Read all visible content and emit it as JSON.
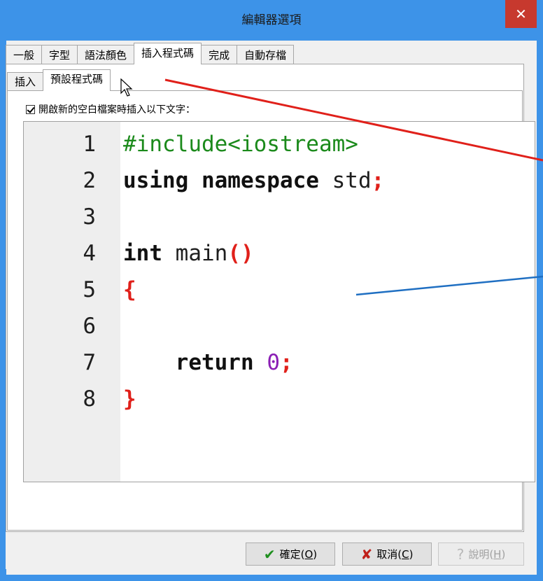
{
  "window": {
    "title": "編輯器選項",
    "close_glyph": "✕"
  },
  "tabs": [
    {
      "label": "一般"
    },
    {
      "label": "字型"
    },
    {
      "label": "語法顏色"
    },
    {
      "label": "插入程式碼",
      "active": true
    },
    {
      "label": "完成"
    },
    {
      "label": "自動存檔"
    }
  ],
  "subtabs": [
    {
      "label": "插入"
    },
    {
      "label": "預設程式碼",
      "active": true
    }
  ],
  "checkbox": {
    "label": "開啟新的空白檔案時插入以下文字：",
    "checked": true
  },
  "editor": {
    "lines": [
      {
        "no": "1",
        "text": "#include<iostream>"
      },
      {
        "no": "2",
        "text": "using namespace std;"
      },
      {
        "no": "3",
        "text": ""
      },
      {
        "no": "4",
        "text": "int main()"
      },
      {
        "no": "5",
        "text": "{"
      },
      {
        "no": "6",
        "text": ""
      },
      {
        "no": "7",
        "text": "    return 0;"
      },
      {
        "no": "8",
        "text": "}"
      }
    ]
  },
  "buttons": {
    "ok": {
      "label": "確定(",
      "key": "O",
      "suffix": ")"
    },
    "cancel": {
      "label": "取消(",
      "key": "C",
      "suffix": ")"
    },
    "help": {
      "label": "說明(",
      "key": "H",
      "suffix": ")"
    }
  },
  "colors": {
    "titlebar": "#3d93e8",
    "close": "#c7392e",
    "preprocessor": "#1b8a1b",
    "punctuation": "#e0201a",
    "number": "#8b1fb5",
    "annotation_red": "#e0201a",
    "annotation_blue": "#1f6fc2"
  }
}
